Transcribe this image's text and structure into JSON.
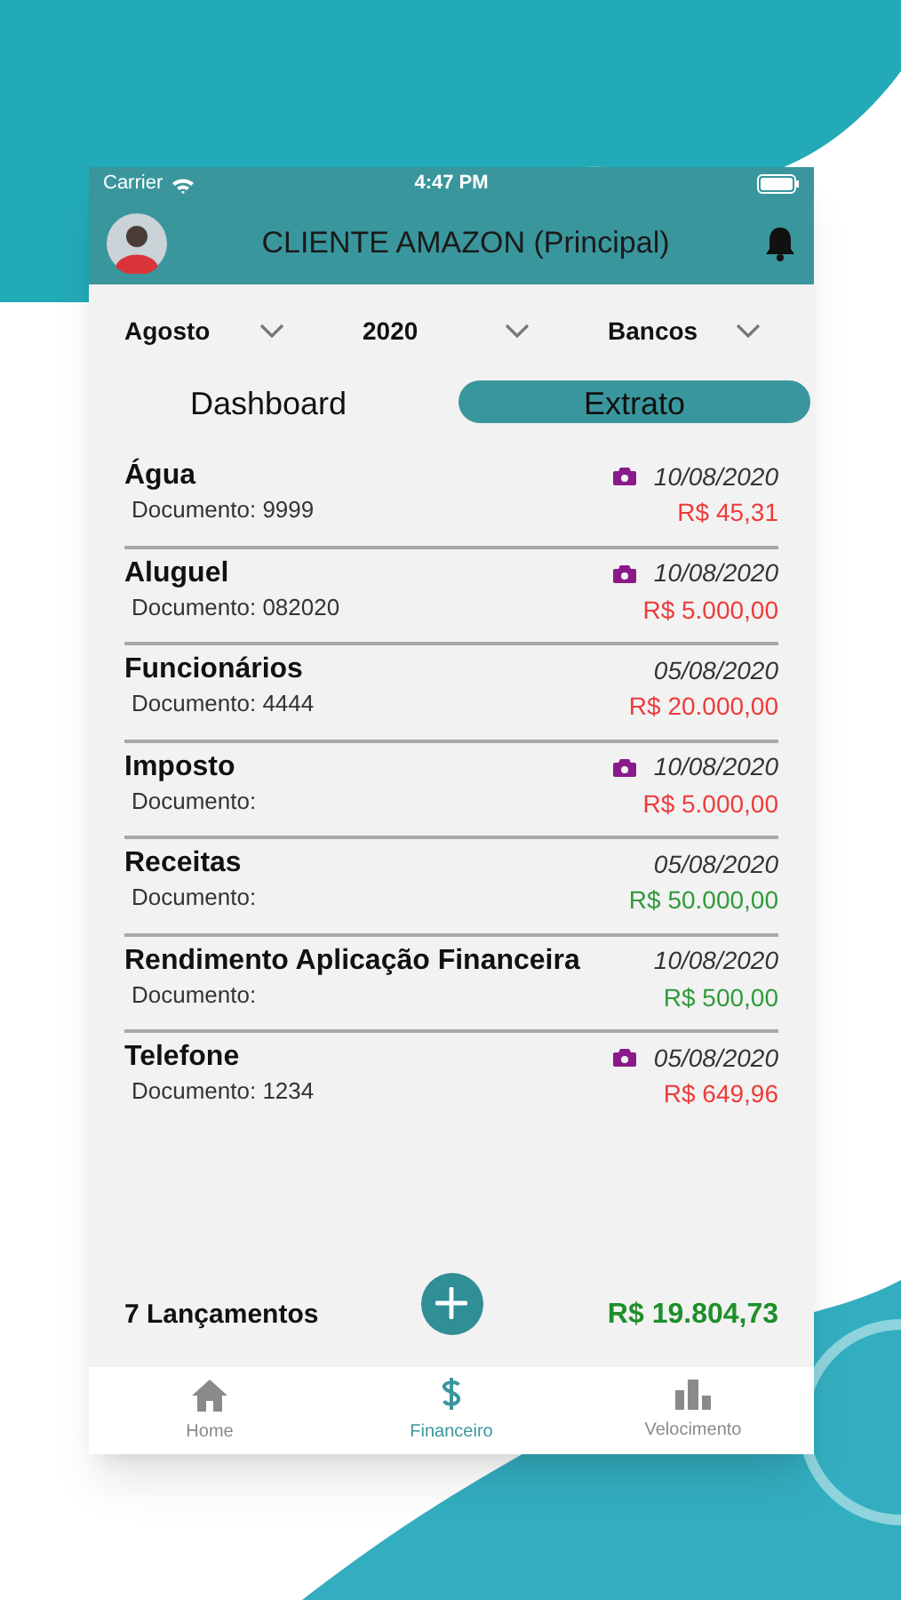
{
  "status_bar": {
    "carrier": "Carrier",
    "time": "4:47 PM"
  },
  "header": {
    "title": "CLIENTE AMAZON (Principal)"
  },
  "filters": [
    {
      "label": "Agosto"
    },
    {
      "label": "2020"
    },
    {
      "label": "Bancos"
    }
  ],
  "tabs": [
    {
      "label": "Dashboard",
      "selected": false
    },
    {
      "label": "Extrato",
      "selected": true
    }
  ],
  "entries": [
    {
      "name": "Água",
      "document": "Documento: 9999",
      "date": "10/08/2020",
      "amount": "R$ 45,31",
      "kind": "expense",
      "attachment": true
    },
    {
      "name": "Aluguel",
      "document": "Documento: 082020",
      "date": "10/08/2020",
      "amount": "R$ 5.000,00",
      "kind": "expense",
      "attachment": true
    },
    {
      "name": "Funcionários",
      "document": "Documento: 4444",
      "date": "05/08/2020",
      "amount": "R$ 20.000,00",
      "kind": "expense",
      "attachment": false
    },
    {
      "name": "Imposto",
      "document": "Documento:",
      "date": "10/08/2020",
      "amount": "R$ 5.000,00",
      "kind": "expense",
      "attachment": true
    },
    {
      "name": "Receitas",
      "document": "Documento:",
      "date": "05/08/2020",
      "amount": "R$ 50.000,00",
      "kind": "income",
      "attachment": false
    },
    {
      "name": "Rendimento Aplicação Financeira",
      "document": "Documento:",
      "date": "10/08/2020",
      "amount": "R$ 500,00",
      "kind": "income",
      "attachment": false
    },
    {
      "name": "Telefone",
      "document": "Documento: 1234",
      "date": "05/08/2020",
      "amount": "R$ 649,96",
      "kind": "expense",
      "attachment": true
    }
  ],
  "summary": {
    "count": "7 Lançamentos",
    "total": "R$ 19.804,73"
  },
  "tab_bar": [
    {
      "label": "Home",
      "selected": false
    },
    {
      "label": "Financeiro",
      "selected": true
    },
    {
      "label": "Velocimento",
      "selected": false
    }
  ]
}
